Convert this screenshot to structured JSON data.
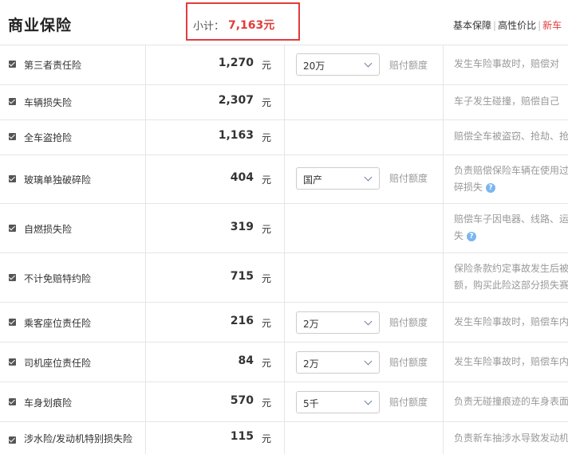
{
  "header": {
    "title": "商业保险",
    "subtotal_label": "小计：",
    "subtotal_value": "7,163元",
    "plans": [
      "基本保障",
      "高性价比",
      "新车"
    ]
  },
  "rows": [
    {
      "name": "第三者责任险",
      "price": "1,270",
      "unit": "元",
      "option": "20万",
      "option_label": "赔付额度",
      "desc": [
        "发生车险事故时，赔偿对"
      ]
    },
    {
      "name": "车辆损失险",
      "price": "2,307",
      "unit": "元",
      "desc": [
        "车子发生碰撞，赔偿自己"
      ]
    },
    {
      "name": "全车盗抢险",
      "price": "1,163",
      "unit": "元",
      "desc": [
        "赔偿全车被盗窃、抢劫、抢"
      ]
    },
    {
      "name": "玻璃单独破碎险",
      "price": "404",
      "unit": "元",
      "option": "国产",
      "option_label": "赔付额度",
      "desc": [
        "负责赔偿保险车辆在使用过",
        "碎损失"
      ]
    },
    {
      "name": "自燃损失险",
      "price": "319",
      "unit": "元",
      "desc": [
        "赔偿车子因电器、线路、运",
        "失"
      ]
    },
    {
      "name": "不计免赔特约险",
      "price": "715",
      "unit": "元",
      "desc": [
        "保险条款约定事故发生后被",
        "额，购买此险这部分损失赛"
      ]
    },
    {
      "name": "乘客座位责任险",
      "price": "216",
      "unit": "元",
      "option": "2万",
      "option_label": "赔付额度",
      "desc": [
        "发生车险事故时，赔偿车内"
      ]
    },
    {
      "name": "司机座位责任险",
      "price": "84",
      "unit": "元",
      "option": "2万",
      "option_label": "赔付额度",
      "desc": [
        "发生车险事故时，赔偿车内"
      ]
    },
    {
      "name": "车身划痕险",
      "price": "570",
      "unit": "元",
      "option": "5千",
      "option_label": "赔付额度",
      "desc": [
        "负责无碰撞痕迹的车身表面"
      ]
    },
    {
      "name": "涉水险/发动机特别损失险",
      "price": "115",
      "unit": "元",
      "desc": [
        "负责新车抽涉水导致发动机"
      ]
    }
  ],
  "help_icon_glyph": "?"
}
